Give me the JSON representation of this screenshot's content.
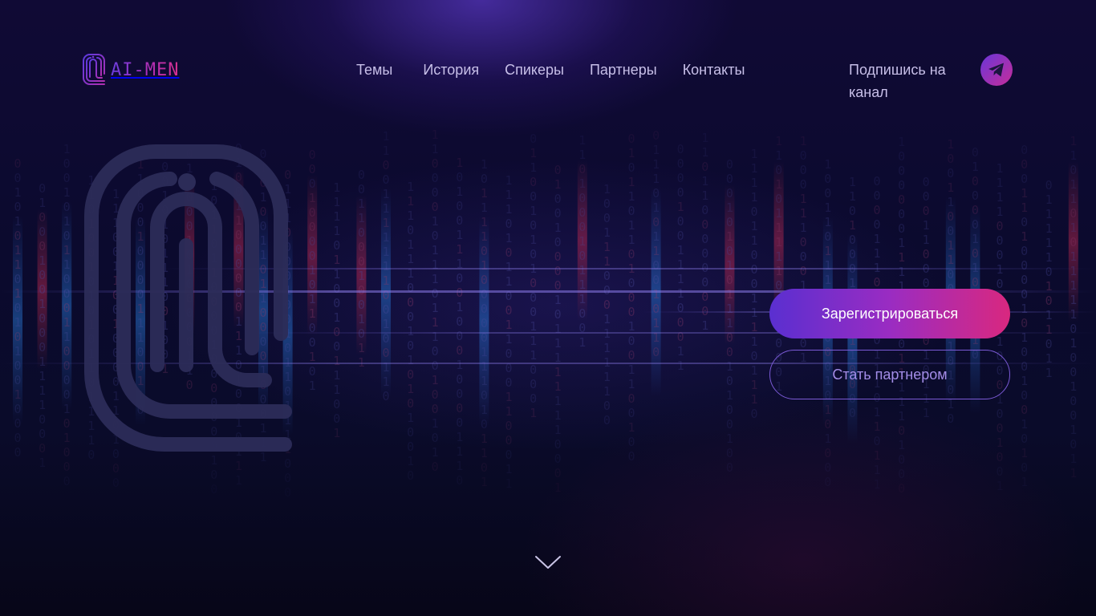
{
  "brand": {
    "logo_text": "AI-MEN",
    "logo_icon": "fingerprint-at-icon"
  },
  "nav": {
    "items": [
      {
        "label": "Темы"
      },
      {
        "label": "История"
      },
      {
        "label": "Спикеры"
      },
      {
        "label": "Партнеры"
      },
      {
        "label": "Контакты"
      }
    ]
  },
  "header": {
    "subscribe_label": "Подпишись на канал",
    "telegram_icon": "telegram-icon"
  },
  "hero": {
    "decor_icon": "fingerprint-at-icon",
    "background": "binary-matrix-rain"
  },
  "actions": {
    "register_label": "Зарегистрироваться",
    "partner_label": "Стать партнером"
  },
  "scroll": {
    "icon": "chevron-down-icon"
  },
  "colors": {
    "accent_start": "#5a2fd0",
    "accent_end": "#d9287f",
    "nav_text": "#c7bfe8",
    "background": "#0b0a2e"
  }
}
